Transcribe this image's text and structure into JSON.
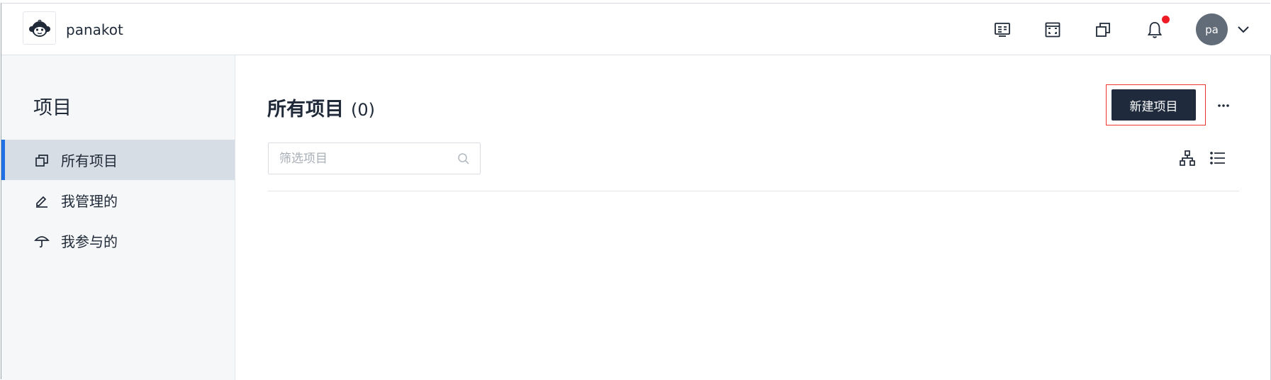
{
  "header": {
    "brand": "panakot",
    "icons": [
      "dashboard-icon",
      "fullscreen-icon",
      "copy-icon",
      "bell-icon"
    ],
    "avatar_text": "pa",
    "notification_dot_color": "#ef1b24"
  },
  "sidebar": {
    "title": "项目",
    "items": [
      {
        "label": "所有项目",
        "icon": "copy-icon",
        "active": true
      },
      {
        "label": "我管理的",
        "icon": "edit-icon",
        "active": false
      },
      {
        "label": "我参与的",
        "icon": "umbrella-icon",
        "active": false
      }
    ]
  },
  "main": {
    "title": "所有项目",
    "count": "(0)",
    "new_button_label": "新建项目",
    "search": {
      "placeholder": "筛选项目",
      "value": ""
    },
    "view_icons": [
      "tree-view-icon",
      "list-view-icon"
    ]
  },
  "colors": {
    "primary_button": "#1f2a3c",
    "active_nav_bg": "#d7dde4",
    "active_nav_accent": "#1f6fe5",
    "sidebar_bg": "#f6f7f9",
    "highlight_frame": "#e8352e"
  }
}
